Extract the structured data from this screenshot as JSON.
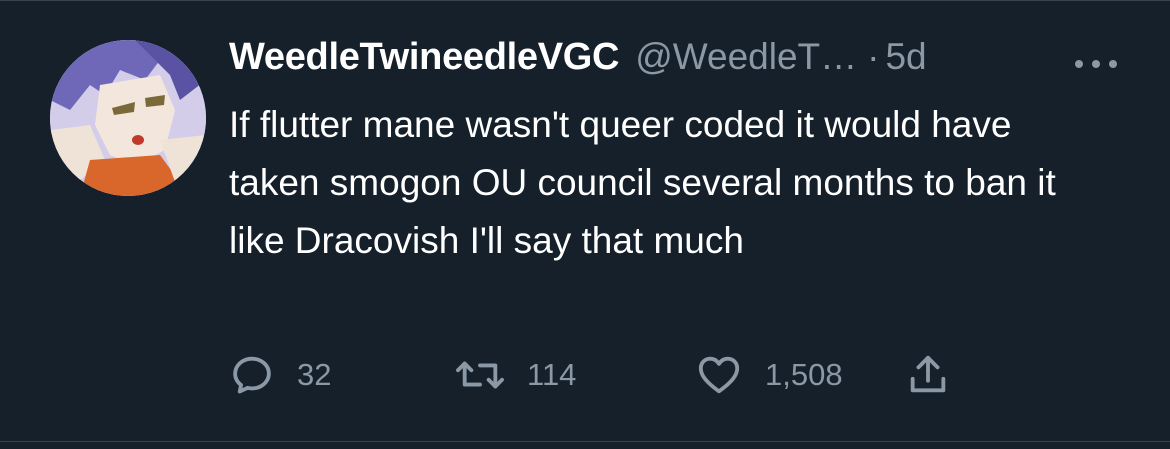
{
  "tweet": {
    "display_name": "WeedleTwineedleVGC",
    "handle": "@WeedleT…",
    "separator": "·",
    "time": "5d",
    "text": "If flutter mane wasn't queer coded it would have taken smogon OU council several months to ban it like Dracovish I'll say that much"
  },
  "actions": {
    "replies": "32",
    "retweets": "114",
    "likes": "1,508"
  },
  "icons": {
    "reply": "reply-bubble-icon",
    "retweet": "retweet-icon",
    "like": "heart-icon",
    "share": "share-upload-icon",
    "more": "more-horizontal-icon"
  },
  "colors": {
    "background": "#15202b",
    "text": "#ffffff",
    "secondary": "#8b98a5",
    "border": "#38444d"
  }
}
